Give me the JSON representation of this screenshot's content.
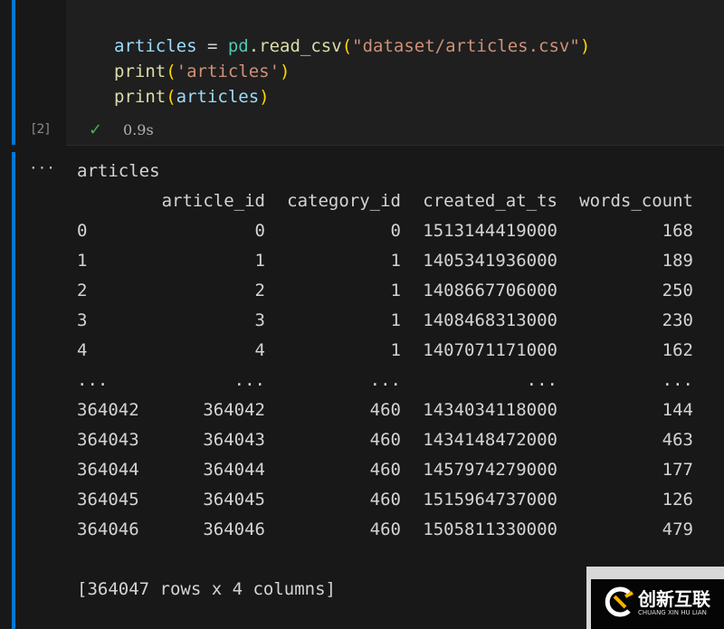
{
  "cell": {
    "exec_count": "[2]",
    "duration": "0.9s",
    "code": {
      "l1": {
        "var": "articles",
        "eq": " = ",
        "mod": "pd",
        "fn": ".read_csv",
        "p1": "(",
        "str": "\"dataset/articles.csv\"",
        "p2": ")"
      },
      "l2": {
        "fn": "print",
        "p1": "(",
        "str": "'articles'",
        "p2": ")"
      },
      "l3": {
        "fn": "print",
        "p1": "(",
        "var": "articles",
        "p2": ")"
      }
    }
  },
  "output": {
    "title": "articles",
    "columns": [
      "article_id",
      "category_id",
      "created_at_ts",
      "words_count"
    ],
    "rows": [
      [
        "0",
        "0",
        "0",
        "1513144419000",
        "168"
      ],
      [
        "1",
        "1",
        "1",
        "1405341936000",
        "189"
      ],
      [
        "2",
        "2",
        "1",
        "1408667706000",
        "250"
      ],
      [
        "3",
        "3",
        "1",
        "1408468313000",
        "230"
      ],
      [
        "4",
        "4",
        "1",
        "1407071171000",
        "162"
      ],
      [
        "...",
        "...",
        "...",
        "...",
        "..."
      ],
      [
        "364042",
        "364042",
        "460",
        "1434034118000",
        "144"
      ],
      [
        "364043",
        "364043",
        "460",
        "1434148472000",
        "463"
      ],
      [
        "364044",
        "364044",
        "460",
        "1457974279000",
        "177"
      ],
      [
        "364045",
        "364045",
        "460",
        "1515964737000",
        "126"
      ],
      [
        "364046",
        "364046",
        "460",
        "1505811330000",
        "479"
      ]
    ],
    "summary": "[364047 rows x 4 columns]"
  },
  "watermark": {
    "brand": "创新互联",
    "sub": "CHUANG XIN HU LIAN"
  }
}
